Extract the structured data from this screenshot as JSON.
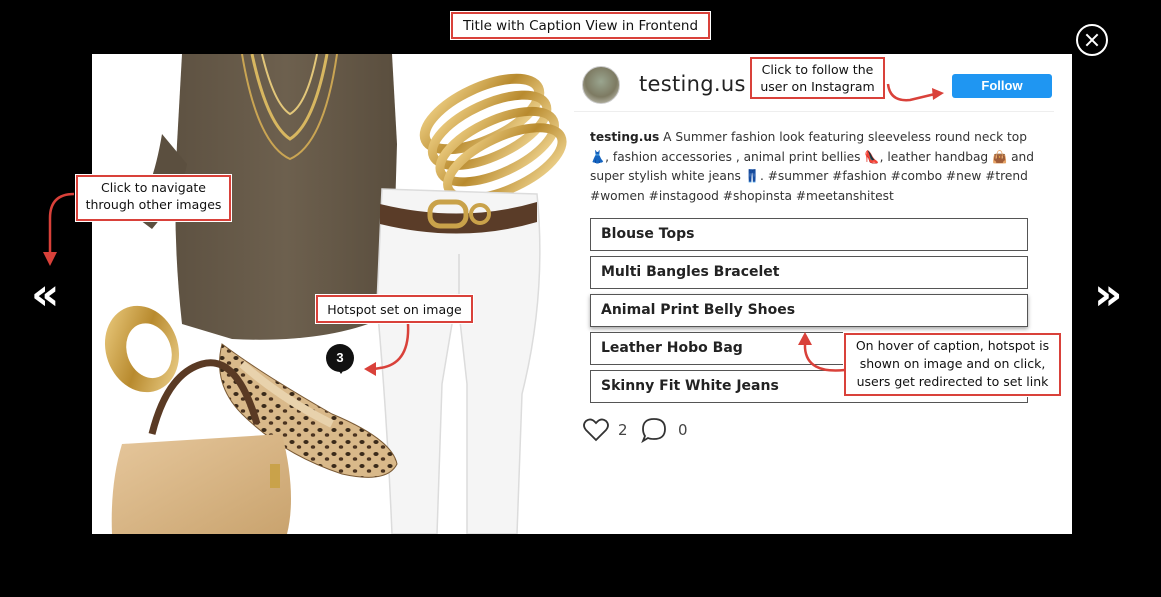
{
  "annotations": {
    "title": "Title with Caption View in Frontend",
    "follow_hint": "Click to follow the user on Instagram",
    "navigate_hint": "Click to navigate through other images",
    "hotspot_hint": "Hotspot set on image",
    "caption_hover_hint": "On hover of caption, hotspot is shown on image and on click, users get redirected to set link"
  },
  "post": {
    "username": "testing.us",
    "follow_label": "Follow",
    "caption_user": "testing.us",
    "caption_text": " A Summer fashion look featuring sleeveless round neck top 👗, fashion accessories , animal print bellies 👠, leather handbag 👜 and super stylish white jeans 👖. #summer #fashion #combo #new #trend #women #instagood #shopinsta #meetanshitest",
    "tags": [
      {
        "label": "Blouse Tops"
      },
      {
        "label": "Multi Bangles Bracelet"
      },
      {
        "label": "Animal Print Belly Shoes"
      },
      {
        "label": "Leather Hobo Bag"
      },
      {
        "label": "Skinny Fit White Jeans"
      }
    ],
    "likes": "2",
    "comments": "0",
    "hotspot_number": "3"
  },
  "nav": {
    "prev_glyph": "«",
    "next_glyph": "»"
  },
  "icons": {
    "close": "close-icon",
    "heart": "heart-icon",
    "comment": "comment-icon"
  },
  "colors": {
    "background": "#000000",
    "annotation_border": "#d9413a",
    "follow_button": "#1f96f2"
  }
}
